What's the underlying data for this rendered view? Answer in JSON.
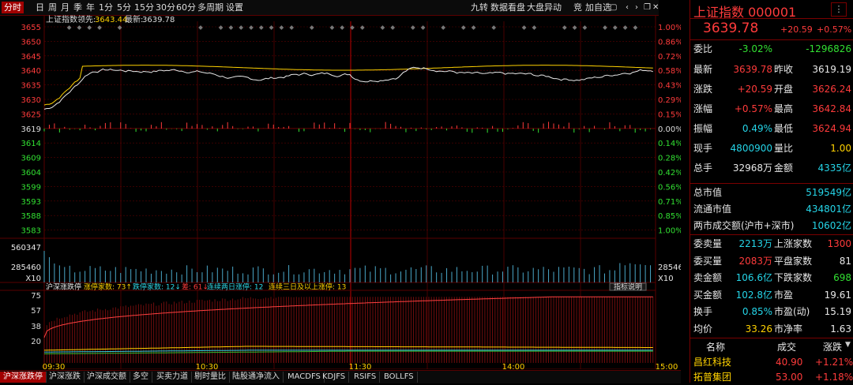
{
  "toolbar": {
    "periods": [
      "分时",
      "日",
      "周",
      "月",
      "季",
      "年",
      "1分",
      "5分",
      "15分",
      "30分",
      "60分",
      "多周期",
      "设置"
    ],
    "right": [
      "九转",
      "数据看盘",
      "大盘异动",
      "竞",
      "加自选"
    ],
    "icons": [
      "lock-icon",
      "back-icon",
      "forward-icon",
      "expand-icon",
      "close-icon"
    ]
  },
  "chart": {
    "legend_title": "上证指数",
    "legend_lead_label": "领先:",
    "legend_lead_value": "3643.44",
    "legend_latest_label": "最新:",
    "legend_latest_value": "3639.78",
    "price_ticks_left": [
      "3655",
      "3650",
      "3645",
      "3640",
      "3635",
      "3630",
      "3625",
      "3619",
      "3614",
      "3609",
      "3604",
      "3599",
      "3593",
      "3588",
      "3583"
    ],
    "pct_ticks_right": [
      "1.00%",
      "0.86%",
      "0.72%",
      "0.58%",
      "0.43%",
      "0.29%",
      "0.15%",
      "0.00%",
      "0.14%",
      "0.28%",
      "0.42%",
      "0.56%",
      "0.71%",
      "0.85%",
      "1.00%"
    ],
    "vol_ticks": [
      "560347",
      "285460"
    ],
    "vol_unit": "X10",
    "limit_title": "沪深涨跌停",
    "limit_up_label": "涨停家数: 73↑",
    "limit_down_label": "跌停家数: 12↓",
    "diff_label": "差: 61↓",
    "two_day_label": "连续两日涨停: 12",
    "three_day_label": "连续三日及以上涨停: 13",
    "indicator_btn": "指标说明",
    "limit_ticks": [
      "75",
      "57",
      "38",
      "20"
    ],
    "time_ticks": [
      "09:30",
      "10:30",
      "11:30",
      "14:00",
      "15:00"
    ]
  },
  "bottom_tabs": [
    "沪深涨跌停",
    "沪深涨跌",
    "沪深成交额",
    "多空",
    "买卖力道",
    "剔时量比",
    "陆股通净流入",
    "MACDFS",
    "KDJFS",
    "RSIFS",
    "BOLLFS"
  ],
  "panel": {
    "name": "上证指数",
    "code": "000001",
    "price": "3639.78",
    "change": "+20.59",
    "change_pct": "+0.57%",
    "rows": [
      {
        "l": "委比",
        "v": "-3.02%",
        "vc": "green",
        "l2": "",
        "v2": "-1296826",
        "v2c": "green"
      },
      {
        "l": "最新",
        "v": "3639.78",
        "vc": "red",
        "l2": "昨收",
        "v2": "3619.19",
        "v2c": "white"
      },
      {
        "l": "涨跌",
        "v": "+20.59",
        "vc": "red",
        "l2": "开盘",
        "v2": "3626.24",
        "v2c": "red"
      },
      {
        "l": "涨幅",
        "v": "+0.57%",
        "vc": "red",
        "l2": "最高",
        "v2": "3642.84",
        "v2c": "red"
      },
      {
        "l": "振幅",
        "v": "0.49%",
        "vc": "cyan",
        "l2": "最低",
        "v2": "3624.94",
        "v2c": "red"
      },
      {
        "l": "现手",
        "v": "4800900",
        "vc": "cyan",
        "l2": "量比",
        "v2": "1.00",
        "v2c": "yel"
      },
      {
        "l": "总手",
        "v": "32968万",
        "vc": "white",
        "l2": "金额",
        "v2": "4335亿",
        "v2c": "cyan"
      }
    ],
    "market": [
      {
        "l": "总市值",
        "v": "519549亿"
      },
      {
        "l": "流通市值",
        "v": "434801亿"
      },
      {
        "l": "两市成交额(沪市+深市)",
        "v": "10602亿"
      }
    ],
    "rows2": [
      {
        "l": "委卖量",
        "v": "2213万",
        "vc": "cyan",
        "l2": "上涨家数",
        "v2": "1300",
        "v2c": "red"
      },
      {
        "l": "委买量",
        "v": "2083万",
        "vc": "red",
        "l2": "平盘家数",
        "v2": "81",
        "v2c": "white"
      },
      {
        "l": "卖金额",
        "v": "106.6亿",
        "vc": "cyan",
        "l2": "下跌家数",
        "v2": "698",
        "v2c": "green"
      },
      {
        "l": "买金额",
        "v": "102.8亿",
        "vc": "cyan",
        "l2": "市盈",
        "v2": "19.61",
        "v2c": "white"
      },
      {
        "l": "换手",
        "v": "0.85%",
        "vc": "cyan",
        "l2": "市盈(动)",
        "v2": "15.19",
        "v2c": "white"
      },
      {
        "l": "均价",
        "v": "33.26",
        "vc": "yel",
        "l2": "市净率",
        "v2": "1.63",
        "v2c": "white"
      }
    ],
    "list_headers": [
      "名称",
      "成交",
      "涨跌"
    ],
    "list": [
      {
        "name": "昌红科技",
        "price": "40.90",
        "pct": "+1.21%"
      },
      {
        "name": "拓普集团",
        "price": "53.00",
        "pct": "+1.18%"
      }
    ]
  },
  "colors": {
    "up": "#ff3b3b",
    "down": "#32e032",
    "grid": "#5a0000",
    "price": "#e8e8e8",
    "avg": "#ffd200"
  }
}
